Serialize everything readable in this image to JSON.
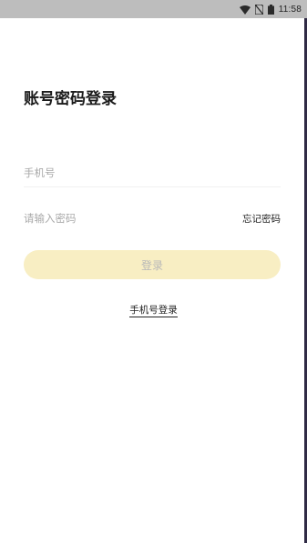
{
  "status_bar": {
    "time": "11:58",
    "icons": [
      "wifi-icon",
      "no-sim-icon",
      "battery-icon"
    ]
  },
  "login": {
    "title": "账号密码登录",
    "phone_placeholder": "手机号",
    "password_placeholder": "请输入密码",
    "forgot_password_label": "忘记密码",
    "submit_label": "登录",
    "switch_label": "手机号登录"
  },
  "colors": {
    "status_bar_bg": "#bdbdbd",
    "button_bg": "#f8eec3",
    "button_text": "#b8b8b8",
    "title_text": "#1b1b1b",
    "placeholder_text": "#a9a9a9",
    "edge_bar": "#2f2a45"
  }
}
